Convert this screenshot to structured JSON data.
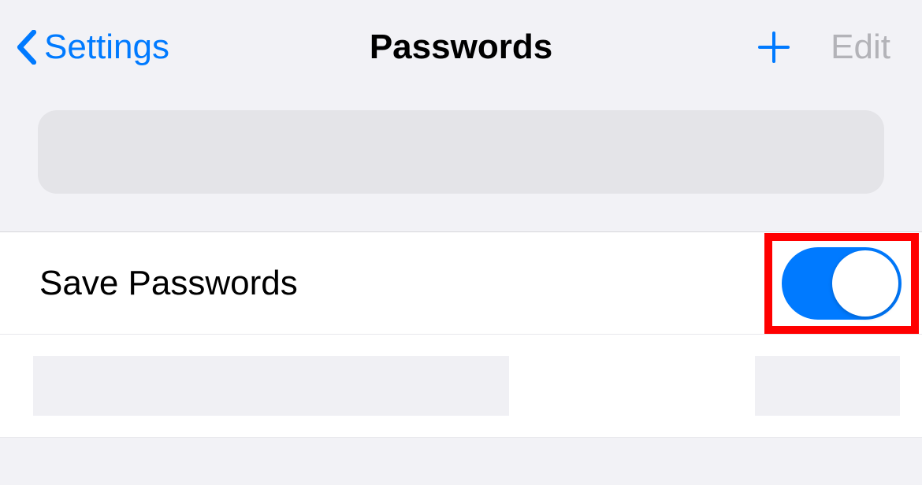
{
  "header": {
    "back_label": "Settings",
    "title": "Passwords",
    "edit_label": "Edit"
  },
  "rows": {
    "save_passwords_label": "Save Passwords",
    "save_passwords_on": true
  }
}
